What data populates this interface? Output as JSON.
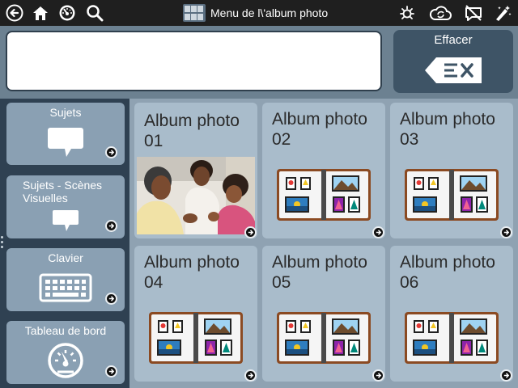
{
  "topbar": {
    "title": "Menu de l\\'album photo",
    "icons": [
      "back-icon",
      "home-icon",
      "dashboard-icon",
      "search-icon",
      "brightness-icon",
      "cloud-sync-icon",
      "speech-off-icon",
      "edit-magic-icon"
    ]
  },
  "message_bar": {
    "text": "",
    "clear_label": "Effacer"
  },
  "sidebar": {
    "items": [
      {
        "label": "Sujets",
        "icon": "speech-bubble-icon"
      },
      {
        "label": "Sujets - Scènes Visuelles",
        "icon": "speech-bubble-small-icon"
      },
      {
        "label": "Clavier",
        "icon": "keyboard-icon"
      },
      {
        "label": "Tableau de bord",
        "icon": "gauge-icon"
      }
    ]
  },
  "albums": [
    {
      "label": "Album photo 01",
      "image": "family-photo"
    },
    {
      "label": "Album photo 02",
      "image": "photo-album-icon"
    },
    {
      "label": "Album photo 03",
      "image": "photo-album-icon"
    },
    {
      "label": "Album photo 04",
      "image": "photo-album-icon"
    },
    {
      "label": "Album photo 05",
      "image": "photo-album-icon"
    },
    {
      "label": "Album photo 06",
      "image": "photo-album-icon"
    }
  ],
  "colors": {
    "topbar": "#1f1f1f",
    "tile": "#a9bccb",
    "sidebar_tile": "#8aa0b3",
    "clear_button": "#3e5466",
    "album_cover": "#8b4a22"
  }
}
